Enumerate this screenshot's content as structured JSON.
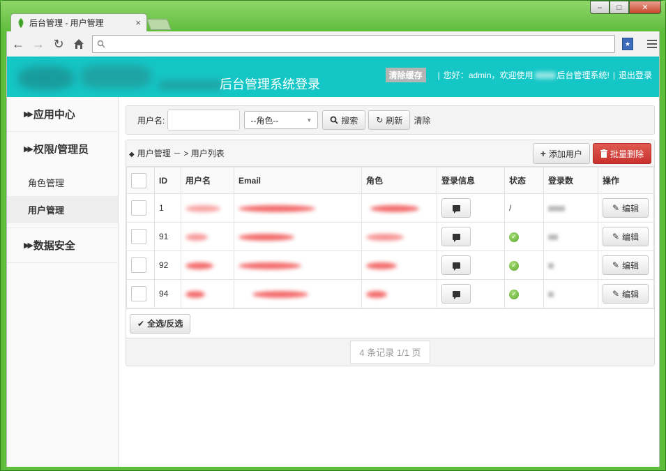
{
  "browser": {
    "tab_title": "后台管理 - 用户管理",
    "tab_close": "×",
    "url": "",
    "window_min": "–",
    "window_max": "□",
    "window_close": "✕"
  },
  "header": {
    "title": "后台管理系统登录",
    "clear_cache": "清除缓存",
    "greeting_prefix": "您好：",
    "username": "admin",
    "welcome_prefix": "，欢迎使用",
    "welcome_suffix": "后台管理系统!",
    "logout": "退出登录",
    "separator": "|"
  },
  "sidebar": {
    "sections": [
      {
        "label": "应用中心"
      },
      {
        "label": "权限/管理员"
      },
      {
        "label": "数据安全"
      }
    ],
    "items": [
      {
        "label": "角色管理"
      },
      {
        "label": "用户管理"
      }
    ]
  },
  "search": {
    "username_label": "用户名:",
    "username_value": "",
    "role_selected": "--角色--",
    "search_button": "搜索",
    "refresh_button": "刷新",
    "clear_link": "清除"
  },
  "list": {
    "breadcrumb": "用户管理 － > 用户列表",
    "add_button": "添加用户",
    "batch_delete_button": "批量删除",
    "columns": [
      "ID",
      "用户名",
      "Email",
      "角色",
      "登录信息",
      "状态",
      "登录数",
      "操作"
    ],
    "rows": [
      {
        "id": "1",
        "status": "/",
        "edit": "编辑"
      },
      {
        "id": "91",
        "status": "",
        "edit": "编辑"
      },
      {
        "id": "92",
        "status": "",
        "edit": "编辑"
      },
      {
        "id": "94",
        "status": "",
        "edit": "编辑"
      }
    ],
    "select_all_button": "全选/反选",
    "pager": "4 条记录 1/1 页"
  }
}
